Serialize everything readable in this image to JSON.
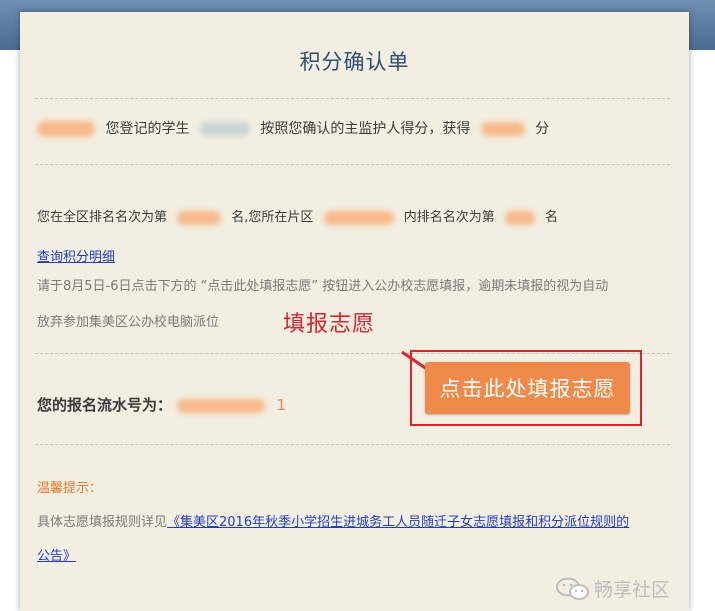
{
  "title": "积分确认单",
  "score_line": {
    "part1": "您登记的学生",
    "part2": "按照您确认的主监护人得分，获得",
    "part3": "分"
  },
  "rank_line": {
    "part1": "您在全区排名名次为第",
    "part2": "名,您所在片区",
    "part3": "内排名名次为第",
    "part4": "名"
  },
  "query_link": "查询积分明细",
  "instruction_line1": "请于8月5日-6日点击下方的 “点击此处填报志愿” 按钮进入公办校志愿填报，逾期未填报的视为自动",
  "instruction_line2": "放弃参加集美区公办校电脑派位",
  "annotation": "填报志愿",
  "serial": {
    "label": "您的报名流水号为：",
    "suffix": "1"
  },
  "apply_button": "点击此处填报志愿",
  "tip": {
    "label": "温馨提示：",
    "prefix": "具体志愿填报规则详见",
    "link_line1": "《集美区2016年秋季小学招生进城务工人员随迁子女志愿填报和积分派位规则的",
    "link_line2": "公告》"
  },
  "watermark": "畅享社区",
  "colors": {
    "header": "#4a6b91",
    "card_bg": "#f3eee2",
    "button": "#f08a4b",
    "annotation_red": "#e0262d",
    "link": "#1f3fc2"
  }
}
